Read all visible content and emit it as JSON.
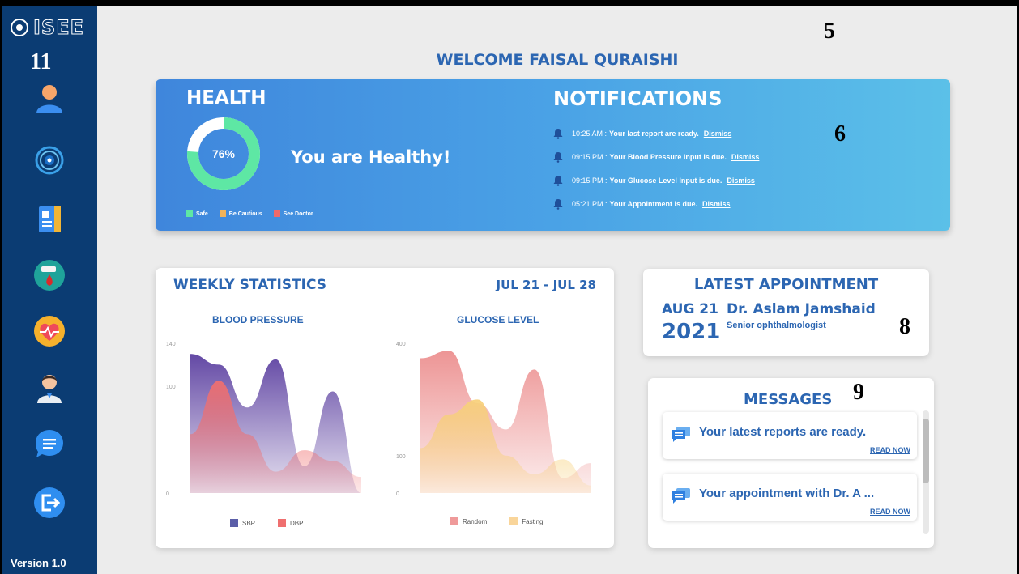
{
  "app": {
    "logo_text": "ISEE",
    "version": "Version 1.0"
  },
  "annotations": {
    "sidebar": "11",
    "welcome": "5",
    "notifications": "6",
    "appointment": "8",
    "messages": "9"
  },
  "welcome": "WELCOME FAISAL QURAISHI",
  "sidebar": {
    "items": [
      {
        "icon": "user-profile-icon"
      },
      {
        "icon": "eye-scan-icon"
      },
      {
        "icon": "medical-records-icon"
      },
      {
        "icon": "blood-drop-icon"
      },
      {
        "icon": "heart-rate-icon"
      },
      {
        "icon": "doctor-icon"
      },
      {
        "icon": "chat-icon"
      },
      {
        "icon": "logout-icon"
      }
    ]
  },
  "health": {
    "title": "HEALTH",
    "percent": 76,
    "percent_label": "76%",
    "status": "You are Healthy!",
    "legend": [
      {
        "label": "Safe",
        "color": "#5ee7a4"
      },
      {
        "label": "Be Cautious",
        "color": "#f2b35a"
      },
      {
        "label": "See Doctor",
        "color": "#f06a6a"
      }
    ]
  },
  "notifications": {
    "title": "NOTIFICATIONS",
    "items": [
      {
        "time": "10:25 AM",
        "message": "Your last report are ready.",
        "action": "Dismiss"
      },
      {
        "time": "09:15 PM",
        "message": "Your Blood Pressure Input is due.",
        "action": "Dismiss"
      },
      {
        "time": "09:15 PM",
        "message": "Your Glucose Level Input is due.",
        "action": "Dismiss"
      },
      {
        "time": "05:21 PM",
        "message": "Your Appointment is due.",
        "action": "Dismiss"
      }
    ]
  },
  "weekly": {
    "title": "WEEKLY STATISTICS",
    "range": "JUL 21 - JUL 28"
  },
  "chart_data": [
    {
      "type": "area",
      "title": "BLOOD PRESSURE",
      "yticks": [
        0,
        100,
        140
      ],
      "ylim": [
        0,
        140
      ],
      "series": [
        {
          "name": "SBP",
          "color": "#5b3fa0",
          "values": [
            130,
            120,
            80,
            125,
            25,
            95,
            0
          ]
        },
        {
          "name": "DBP",
          "color": "#ef6f6f",
          "values": [
            55,
            105,
            55,
            20,
            40,
            30,
            15
          ]
        }
      ]
    },
    {
      "type": "area",
      "title": "GLUCOSE LEVEL",
      "yticks": [
        0,
        100,
        400
      ],
      "ylim": [
        0,
        400
      ],
      "series": [
        {
          "name": "Random",
          "color": "#ec8f8f",
          "values": [
            360,
            380,
            240,
            170,
            330,
            40,
            80
          ]
        },
        {
          "name": "Fasting",
          "color": "#f7d07a",
          "values": [
            120,
            210,
            250,
            100,
            50,
            90,
            20
          ]
        }
      ]
    }
  ],
  "appointment": {
    "title": "LATEST APPOINTMENT",
    "date": "AUG 21",
    "year": "2021",
    "doctor": "Dr. Aslam Jamshaid",
    "role": "Senior ophthalmologist"
  },
  "messages": {
    "title": "MESSAGES",
    "items": [
      {
        "text": "Your latest reports are ready.",
        "action": "READ NOW"
      },
      {
        "text": "Your appointment with Dr. A ...",
        "action": "READ NOW"
      }
    ]
  }
}
